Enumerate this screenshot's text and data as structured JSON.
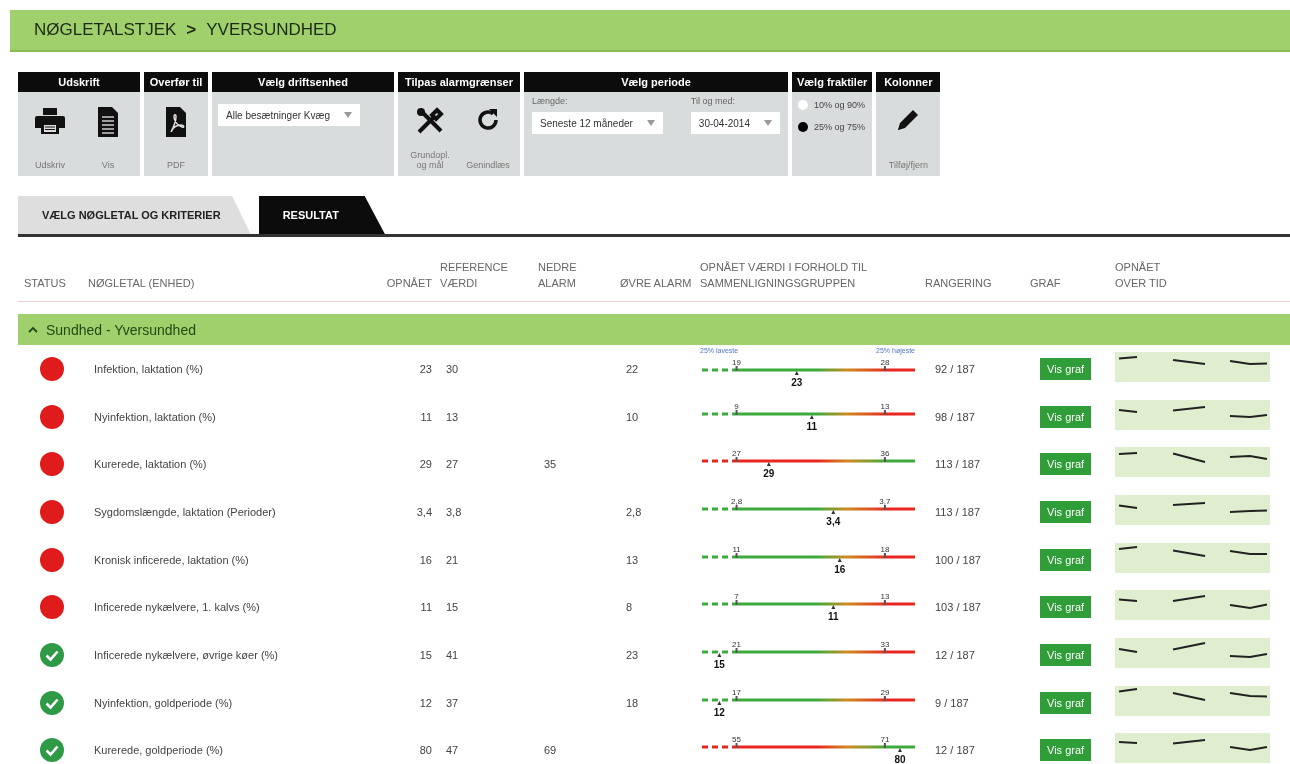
{
  "breadcrumb": {
    "items": [
      "NØGLETALSTJEK",
      "YVERSUNDHED"
    ],
    "separator": ">"
  },
  "toolbar": [
    {
      "kind": "buttons",
      "title": "Udskrift",
      "buttons": [
        {
          "kind": "printer",
          "label": "Udskriv"
        },
        {
          "kind": "document",
          "label": "Vis"
        }
      ]
    },
    {
      "kind": "buttons",
      "title": "Overfør til",
      "buttons": [
        {
          "kind": "pdf",
          "label": "PDF"
        }
      ]
    },
    {
      "kind": "select",
      "title": "Vælg driftsenhed",
      "value": "Alle besætninger Kvæg"
    },
    {
      "kind": "buttons",
      "title": "Tilpas alarmgrænser",
      "buttons": [
        {
          "kind": "tools",
          "label": "Grundopl. og mål"
        },
        {
          "kind": "reload",
          "label": "Genindlæs"
        }
      ]
    },
    {
      "kind": "period",
      "title": "Vælg periode",
      "fields": [
        {
          "label": "Længde:",
          "value": "Seneste 12 måneder"
        },
        {
          "label": "Til og med:",
          "value": "30-04-2014"
        }
      ]
    },
    {
      "kind": "radios",
      "title": "Vælg fraktiler",
      "options": [
        {
          "label": "10% og 90%",
          "selected": false
        },
        {
          "label": "25% og 75%",
          "selected": true
        }
      ]
    },
    {
      "kind": "buttons",
      "title": "Kolonner",
      "buttons": [
        {
          "kind": "pencil",
          "label": "Tilføj/fjern"
        }
      ]
    }
  ],
  "tabs": [
    {
      "label": "VÆLG NØGLETAL OG KRITERIER",
      "selected": false
    },
    {
      "label": "RESULTAT",
      "selected": true
    }
  ],
  "table": {
    "columns": [
      "STATUS",
      "NØGLETAL (ENHED)",
      "OPNÅET",
      "REFERENCE VÆRDI",
      "NEDRE ALARM",
      "ØVRE ALARM",
      "OPNÅET VÆRDI I FORHOLD TIL SAMMENLIGNINGSGRUPPEN",
      "RANGERING",
      "GRAF",
      "OPNÅET OVER TID"
    ],
    "section": {
      "title": "Sundhed - Yversundhed",
      "expanded": true,
      "quartile_labels": [
        "25% laveste",
        "25% højeste"
      ],
      "rows": [
        {
          "kind": "alarm",
          "name": "Infektion, laktation (%)",
          "achieved": "23",
          "reference": "30",
          "upper_alarm": "22",
          "comparison": {
            "kind": "low_good",
            "low": "19",
            "high": "28",
            "value": "23",
            "level": 0.45
          },
          "rank": "92 / 187",
          "button": "Vis graf"
        },
        {
          "kind": "alarm",
          "name": "Nyinfektion, laktation (%)",
          "achieved": "11",
          "reference": "13",
          "upper_alarm": "10",
          "comparison": {
            "kind": "low_good",
            "low": "9",
            "high": "13",
            "value": "11",
            "level": 0.52
          },
          "rank": "98 / 187",
          "button": "Vis graf"
        },
        {
          "kind": "alarm",
          "name": "Kurerede, laktation (%)",
          "achieved": "29",
          "reference": "27",
          "lower_alarm": "35",
          "comparison": {
            "kind": "high_good",
            "low": "27",
            "high": "36",
            "value": "29",
            "level": 0.32
          },
          "rank": "113 / 187",
          "button": "Vis graf"
        },
        {
          "kind": "alarm",
          "name": "Sygdomslængde, laktation (Perioder)",
          "achieved": "3,4",
          "reference": "3,8",
          "upper_alarm": "2,8",
          "comparison": {
            "kind": "low_good",
            "low": "2,8",
            "high": "3,7",
            "value": "3,4",
            "level": 0.62
          },
          "rank": "113 / 187",
          "button": "Vis graf"
        },
        {
          "kind": "alarm",
          "name": "Kronisk inficerede, laktation (%)",
          "achieved": "16",
          "reference": "21",
          "upper_alarm": "13",
          "comparison": {
            "kind": "low_good",
            "low": "11",
            "high": "18",
            "value": "16",
            "level": 0.65
          },
          "rank": "100 / 187",
          "button": "Vis graf"
        },
        {
          "kind": "alarm",
          "name": "Inficerede nykælvere, 1. kalvs (%)",
          "achieved": "11",
          "reference": "15",
          "upper_alarm": "8",
          "comparison": {
            "kind": "low_good",
            "low": "7",
            "high": "13",
            "value": "11",
            "level": 0.62
          },
          "rank": "103 / 187",
          "button": "Vis graf"
        },
        {
          "kind": "ok",
          "name": "Inficerede nykælvere, øvrige køer (%)",
          "achieved": "15",
          "reference": "41",
          "upper_alarm": "23",
          "comparison": {
            "kind": "low_good",
            "low": "21",
            "high": "33",
            "value": "15",
            "level": 0.09
          },
          "rank": "12 / 187",
          "button": "Vis graf"
        },
        {
          "kind": "ok",
          "name": "Nyinfektion, goldperiode (%)",
          "achieved": "12",
          "reference": "37",
          "upper_alarm": "18",
          "comparison": {
            "kind": "low_good",
            "low": "17",
            "high": "29",
            "value": "12",
            "level": 0.09
          },
          "rank": "9 / 187",
          "button": "Vis graf"
        },
        {
          "kind": "ok",
          "name": "Kurerede, goldperiode (%)",
          "achieved": "80",
          "reference": "47",
          "lower_alarm": "69",
          "comparison": {
            "kind": "high_good",
            "low": "55",
            "high": "71",
            "value": "80",
            "level": 0.93
          },
          "rank": "12 / 187",
          "button": "Vis graf"
        }
      ]
    }
  }
}
